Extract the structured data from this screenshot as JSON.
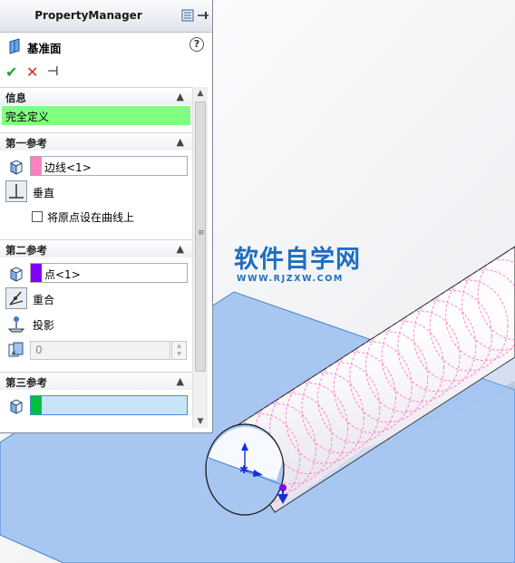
{
  "panel": {
    "title": "PropertyManager",
    "feature_name": "基准面",
    "help_label": "?",
    "actions": {
      "ok": "✔",
      "cancel": "✕",
      "pin": "⊣"
    }
  },
  "sections": {
    "info": {
      "title": "信息",
      "status": "完全定义",
      "status_color": "#80ff80"
    },
    "first_ref": {
      "title": "第一参考",
      "selection": "边线<1>",
      "swatch_color": "#ff80c0",
      "constraint": "垂直",
      "checkbox_label": "将原点设在曲线上",
      "checkbox_checked": false
    },
    "second_ref": {
      "title": "第二参考",
      "selection": "点<1>",
      "swatch_color": "#8000ff",
      "constraint_coincident": "重合",
      "constraint_project": "投影",
      "count_value": "0"
    },
    "third_ref": {
      "title": "第三参考",
      "selection": "",
      "swatch_color": "#00c040"
    }
  },
  "watermark": {
    "main": "软件自学网",
    "sub": "WWW.RJZXW.COM"
  },
  "icons": {
    "feature": "plane-icon",
    "collapse": "chevron-up-icon",
    "selection": "cube-face-icon"
  }
}
